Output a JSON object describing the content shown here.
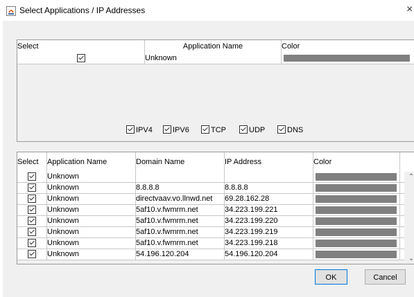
{
  "window": {
    "title": "Select Applications / IP Addresses",
    "close_label": "×"
  },
  "top_table": {
    "headers": {
      "select": "Select",
      "app_name": "Application Name",
      "color": "Color"
    },
    "rows": [
      {
        "selected": true,
        "app_name": "Unknown",
        "color": "#808080"
      }
    ]
  },
  "filters": [
    {
      "label": "IPV4",
      "checked": true
    },
    {
      "label": "IPV6",
      "checked": true
    },
    {
      "label": "TCP",
      "checked": true
    },
    {
      "label": "UDP",
      "checked": true
    },
    {
      "label": "DNS",
      "checked": true
    }
  ],
  "bottom_table": {
    "headers": {
      "select": "Select",
      "app_name": "Application Name",
      "domain": "Domain Name",
      "ip": "IP Address",
      "color": "Color"
    },
    "rows": [
      {
        "selected": true,
        "app_name": "Unknown",
        "domain": "",
        "ip": "",
        "color": "#808080"
      },
      {
        "selected": true,
        "app_name": "Unknown",
        "domain": "8.8.8.8",
        "ip": "8.8.8.8",
        "color": "#808080"
      },
      {
        "selected": true,
        "app_name": "Unknown",
        "domain": "directvaav.vo.llnwd.net",
        "ip": "69.28.162.28",
        "color": "#808080"
      },
      {
        "selected": true,
        "app_name": "Unknown",
        "domain": "5af10.v.fwmrm.net",
        "ip": "34.223.199.221",
        "color": "#808080"
      },
      {
        "selected": true,
        "app_name": "Unknown",
        "domain": "5af10.v.fwmrm.net",
        "ip": "34.223.199.220",
        "color": "#808080"
      },
      {
        "selected": true,
        "app_name": "Unknown",
        "domain": "5af10.v.fwmrm.net",
        "ip": "34.223.199.219",
        "color": "#808080"
      },
      {
        "selected": true,
        "app_name": "Unknown",
        "domain": "5af10.v.fwmrm.net",
        "ip": "34.223.199.218",
        "color": "#808080"
      },
      {
        "selected": true,
        "app_name": "Unknown",
        "domain": "54.196.120.204",
        "ip": "54.196.120.204",
        "color": "#808080"
      }
    ]
  },
  "buttons": {
    "ok": "OK",
    "cancel": "Cancel"
  },
  "colors": {
    "dialog_bg": "#f0f0f0",
    "swatch": "#808080",
    "focus_border": "#0078d7"
  }
}
